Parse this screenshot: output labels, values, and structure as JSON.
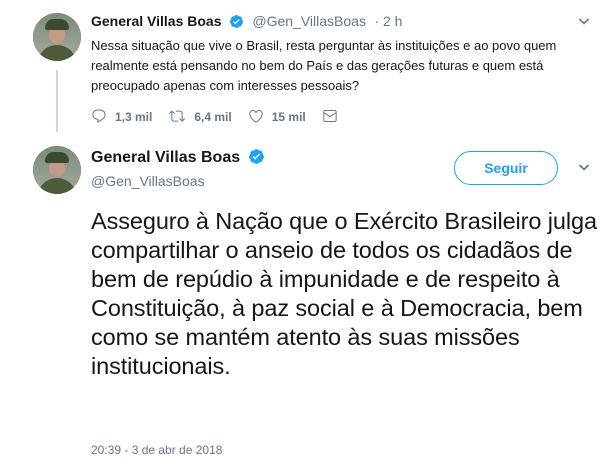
{
  "reply_tweet": {
    "author_name": "General Villas Boas",
    "handle": "@Gen_VillasBoas",
    "time": "· 2 h",
    "text": "Nessa situação que vive o Brasil, resta perguntar às instituições e ao povo quem realmente está pensando no bem do País e das gerações futuras e quem está preocupado apenas com interesses pessoais?",
    "replies": "1,3 mil",
    "retweets": "6,4 mil",
    "likes": "15 mil"
  },
  "main_tweet": {
    "author_name": "General Villas Boas",
    "handle": "@Gen_VillasBoas",
    "follow_label": "Seguir",
    "text": "Asseguro à Nação que o Exército Brasileiro julga compartilhar o anseio de todos os cidadãos de bem de repúdio à impunidade e de respeito à Constituição, à paz social e à Democracia, bem como se mantém atento às suas missões institucionais.",
    "timestamp": "20:39 - 3 de abr de 2018"
  },
  "colors": {
    "brand": "#1da1f2",
    "secondary_text": "#657786",
    "primary_text": "#14171a"
  },
  "icons": [
    "verified-icon",
    "chevron-down-icon",
    "reply-icon",
    "retweet-icon",
    "like-icon",
    "direct-message-icon"
  ]
}
